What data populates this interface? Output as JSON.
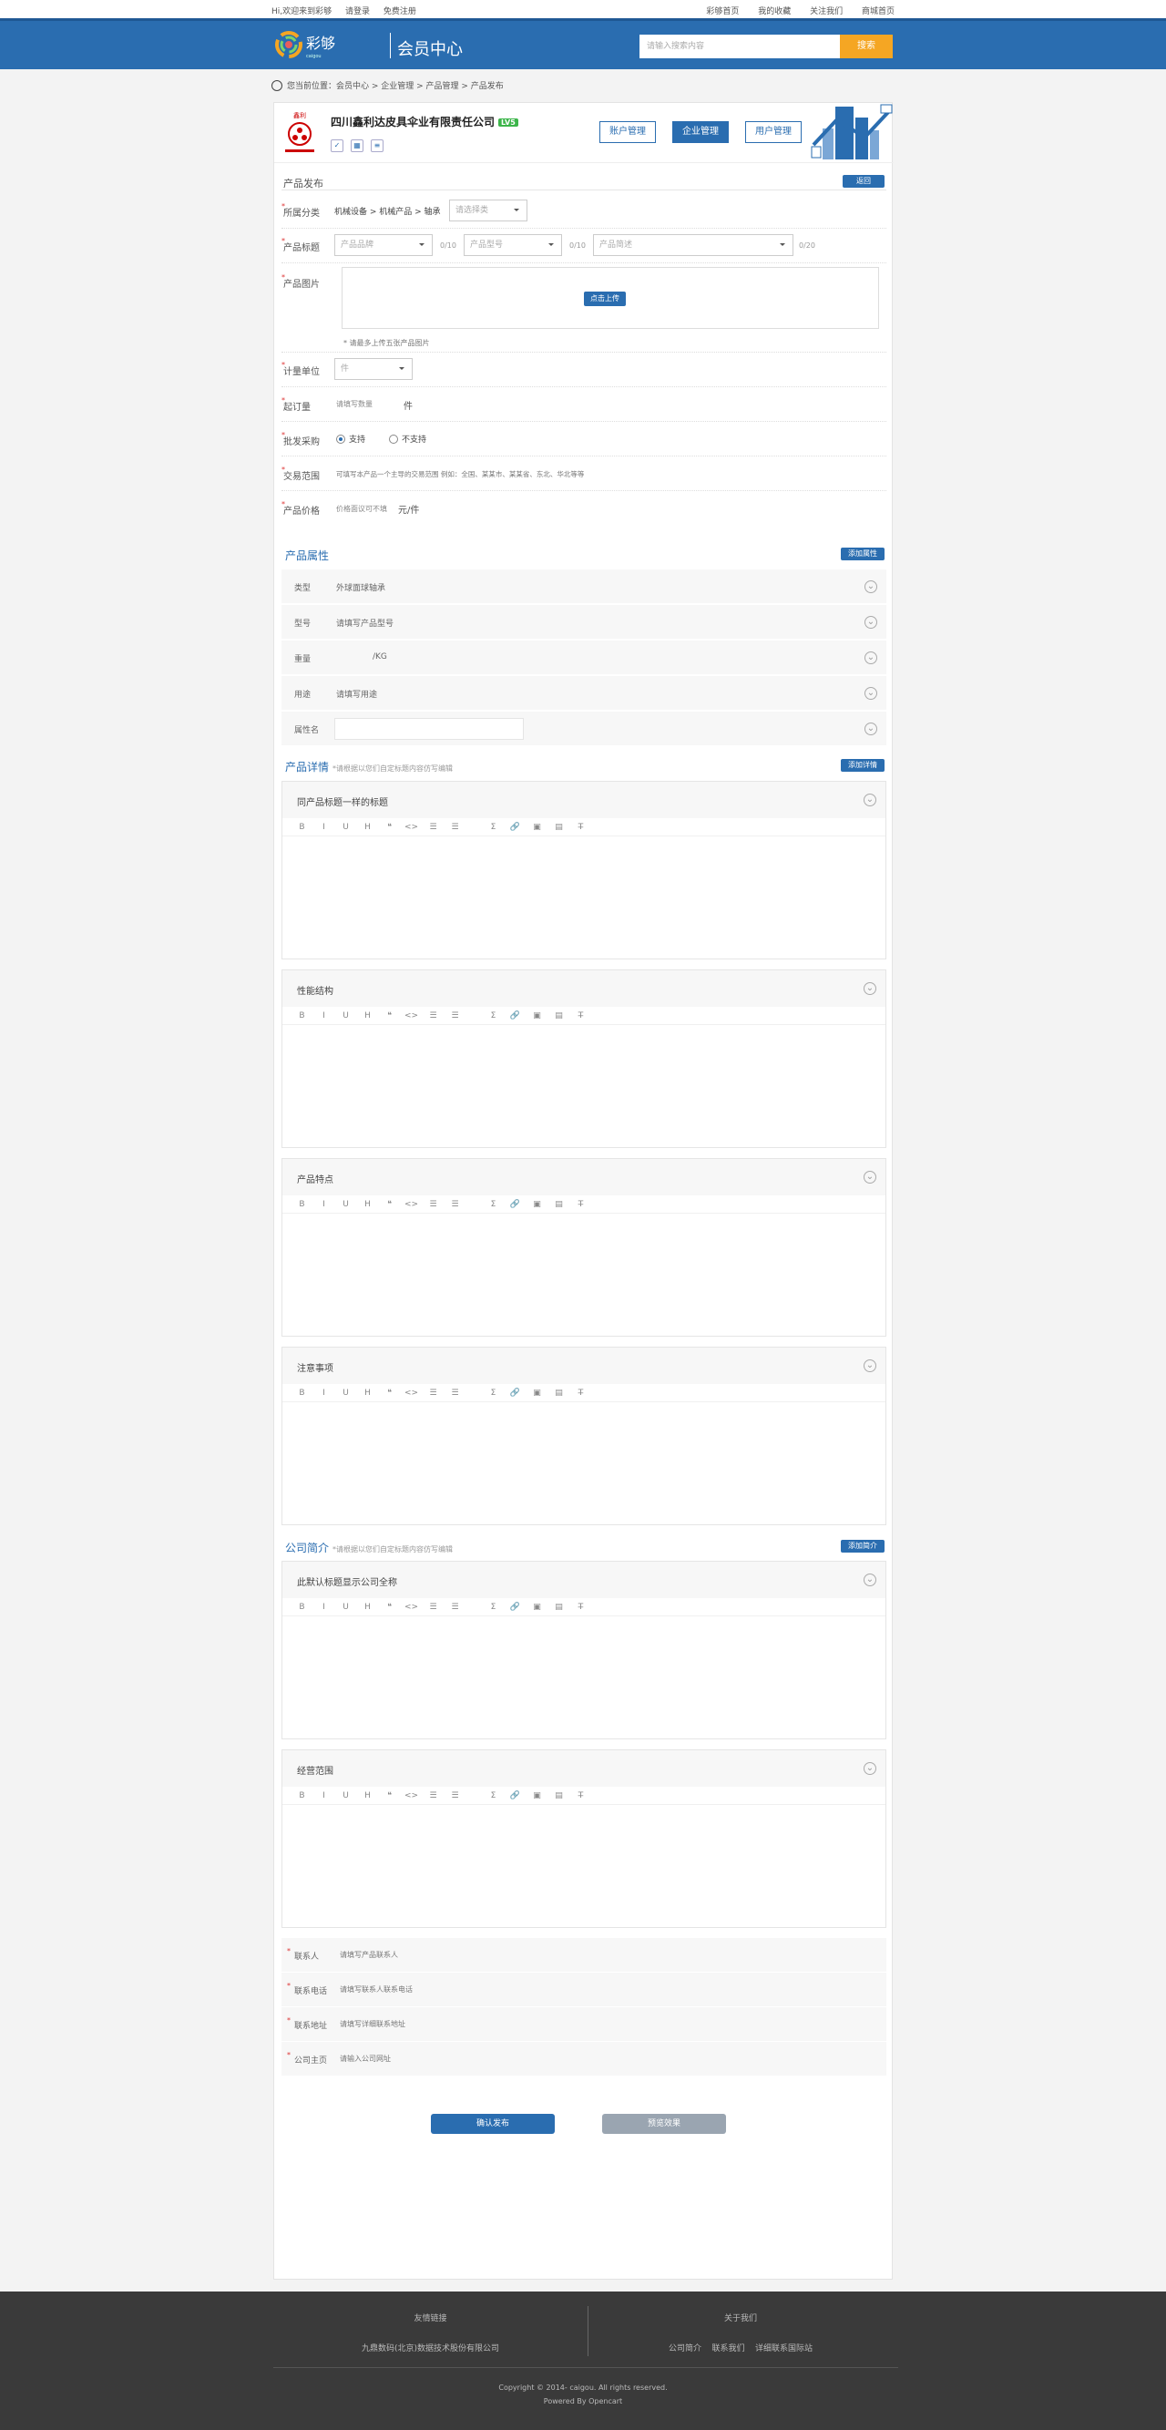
{
  "topbar": {
    "left": [
      "Hi,欢迎来到彩够",
      "请登录",
      "免费注册"
    ],
    "right": [
      "彩够首页",
      "我的收藏",
      "关注我们",
      "商城首页"
    ]
  },
  "header": {
    "title": "会员中心",
    "search_placeholder": "请输入搜索内容",
    "search_button": "搜索"
  },
  "breadcrumb": "您当前位置：会员中心 > 企业管理 > 产品管理 > 产品发布",
  "company": {
    "name": "四川鑫利达皮具伞业有限责任公司",
    "level": "LV5",
    "tabs": [
      "账户管理",
      "企业管理",
      "用户管理"
    ],
    "active_tab": 1
  },
  "publish": {
    "title": "产品发布",
    "back_button": "返回",
    "category_label": "所属分类",
    "category_value": "机械设备 > 机械产品 > 轴承",
    "category_select": "请选择类",
    "product_title_label": "产品标题",
    "brand_select": "产品品牌",
    "brand_count": "0/10",
    "model_select": "产品型号",
    "model_count": "0/10",
    "desc_select": "产品简述",
    "desc_count": "0/20",
    "image_label": "产品图片",
    "upload_button": "点击上传",
    "image_tip": "* 请最多上传五张产品图片",
    "unit_label": "计量单位",
    "unit_value": "件",
    "moq_label": "起订量",
    "moq_placeholder": "请填写数量",
    "moq_unit": "件",
    "sample_label": "批发采购",
    "sample_yes": "支持",
    "sample_no": "不支持",
    "range_label": "交易范围",
    "range_text": "可填写本产品一个主导的交易范围 例如：全国、某某市、某某省、东北、华北等等",
    "price_label": "产品价格",
    "price_placeholder": "价格面议可不填",
    "price_unit": "元/件"
  },
  "attrs": {
    "title": "产品属性",
    "add_button": "添加属性",
    "rows": [
      {
        "k": "类型",
        "v": "外球面球轴承"
      },
      {
        "k": "型号",
        "v": "请填写产品型号"
      },
      {
        "k": "重量",
        "v": "/KG"
      },
      {
        "k": "用途",
        "v": "请填写用途"
      },
      {
        "k": "属性名",
        "v": ""
      }
    ]
  },
  "details": {
    "title": "产品详情",
    "note": "*请根据以您们自定标题内容仿写编辑",
    "add_button": "添加详情",
    "toolbar": [
      "B",
      "I",
      "U",
      "H",
      "❝",
      "<>",
      "☰",
      "☰",
      "Σ",
      "🔗",
      "▣",
      "▤",
      "T̶"
    ],
    "editors": [
      "同产品标题一样的标题",
      "性能结构",
      "产品特点",
      "注意事项"
    ]
  },
  "intro": {
    "title": "公司简介",
    "note": "*请根据以您们自定标题内容仿写编辑",
    "add_button": "添加简介",
    "editors": [
      "此默认标题显示公司全称",
      "经营范围"
    ]
  },
  "contact": [
    {
      "k": "联系人",
      "v": "请填写产品联系人"
    },
    {
      "k": "联系电话",
      "v": "请填写联系人联系电话"
    },
    {
      "k": "联系地址",
      "v": "请填写详细联系地址"
    },
    {
      "k": "公司主页",
      "v": "请输入公司网址"
    }
  ],
  "actions": {
    "confirm": "确认发布",
    "preview": "预览效果"
  },
  "footer": {
    "col1_title": "友情链接",
    "col1_text": "九鼎数码(北京)数据技术股份有限公司",
    "col2_title": "关于我们",
    "col2_links": [
      "公司简介",
      "联系我们",
      "详细联系国际站"
    ],
    "copyright": "Copyright © 2014- caigou. All rights reserved.",
    "powered": "Powered By Opencart"
  },
  "colors": {
    "brand": "#2a6db0",
    "accent": "#f5a623"
  }
}
